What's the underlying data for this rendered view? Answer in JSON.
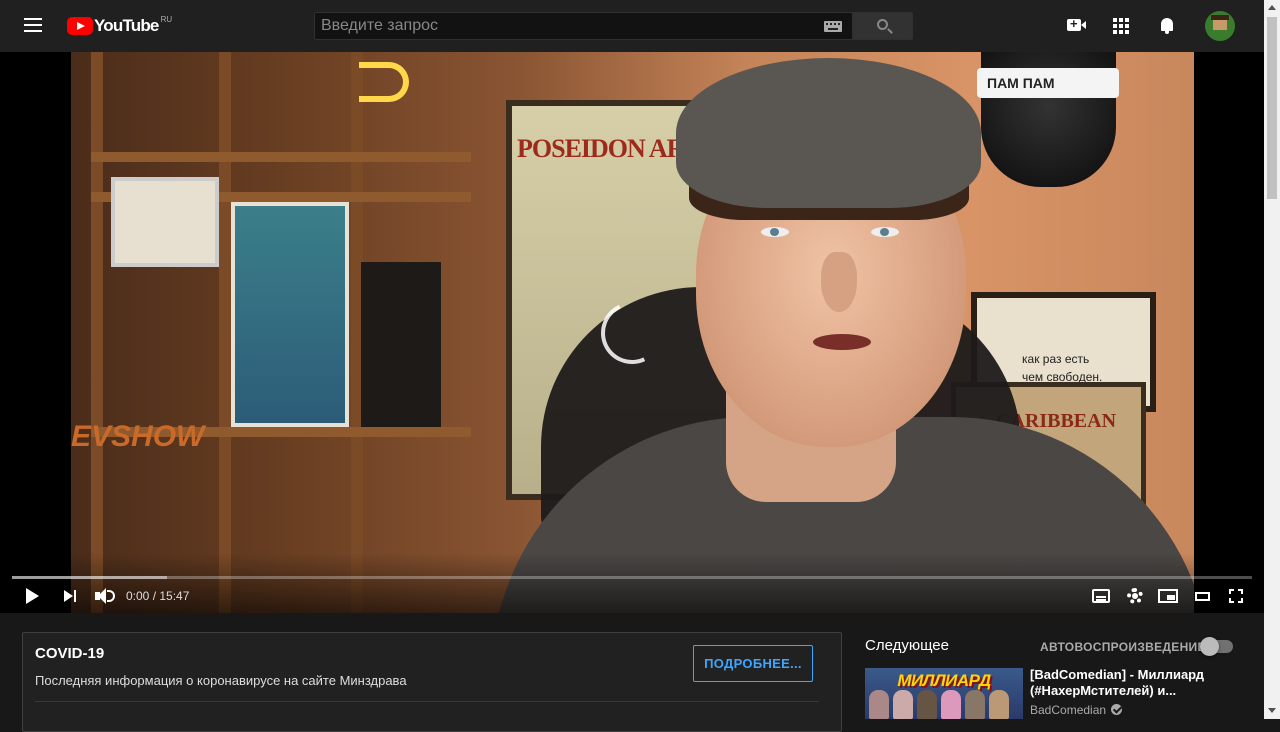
{
  "header": {
    "logo_text": "YouTube",
    "logo_region": "RU",
    "search_placeholder": "Введите запрос"
  },
  "player": {
    "current_time": "0:00",
    "duration": "15:47",
    "time_display": "0:00 / 15:47",
    "played_fraction": 0.0,
    "loaded_fraction": 0.125,
    "overlay_texts": {
      "poster": "POSEIDON ARCTI",
      "sign": "как раз есть\nчем свободен.",
      "rum": "CARIBBEAN\nRUM",
      "mic_band": "ПАМ ПАМ",
      "show": "EVSHOW"
    }
  },
  "covid": {
    "title": "COVID-19",
    "text": "Последняя информация о коронавирусе на сайте Минздрава",
    "button": "ПОДРОБНЕЕ..."
  },
  "sidebar": {
    "next_label": "Следующее",
    "autoplay_label": "АВТОВОСПРОИЗВЕДЕНИЕ",
    "autoplay_on": false,
    "next_video": {
      "thumbnail_text": "МИЛЛИАРД",
      "title": "[BadComedian] - Миллиард (#НахерМстителей) и...",
      "channel": "BadComedian"
    }
  },
  "colors": {
    "accent_red": "#ff0000",
    "link_blue": "#3ea6ff",
    "background": "#181818",
    "topbar": "#202020"
  }
}
